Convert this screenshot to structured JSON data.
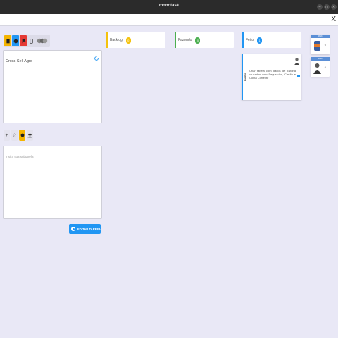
{
  "window": {
    "title": "monotask",
    "controls": [
      "–",
      "◻",
      "✕"
    ]
  },
  "topbar": {
    "close_label": "X"
  },
  "left_panel": {
    "toolbar": [
      {
        "icon": "paper-icon",
        "color": "#f4b400"
      },
      {
        "icon": "check-circle-icon",
        "color": "#2196f3"
      },
      {
        "icon": "flag-icon",
        "color": "#e53935"
      },
      {
        "icon": "phone-icon",
        "color": "#dcdbe8"
      },
      {
        "icon": "avatars-icon",
        "color": "#dcdbe8"
      }
    ],
    "task_title": "Cross Sell Agro",
    "subtask_toolbar": [
      "+",
      "☆",
      "●",
      "👥"
    ],
    "subtask_placeholder": "Insira sua subtarefa",
    "edit_button": "EDITAR TAREFA"
  },
  "columns": [
    {
      "name": "Backlog",
      "count": "0",
      "color": "#f4c20d"
    },
    {
      "name": "Fazendo",
      "count": "0",
      "color": "#4caf50"
    },
    {
      "name": "Feito",
      "count": "1",
      "color": "#2196f3"
    }
  ],
  "card": {
    "tag": "Backlog",
    "description": "Criar tabela com dados de Estoria cruzados com Seguradaa, Cartão e Conta Corrente"
  },
  "mini_cards": [
    {
      "header": "TASK",
      "count": "0"
    },
    {
      "header": "TASK",
      "count": "0"
    }
  ]
}
